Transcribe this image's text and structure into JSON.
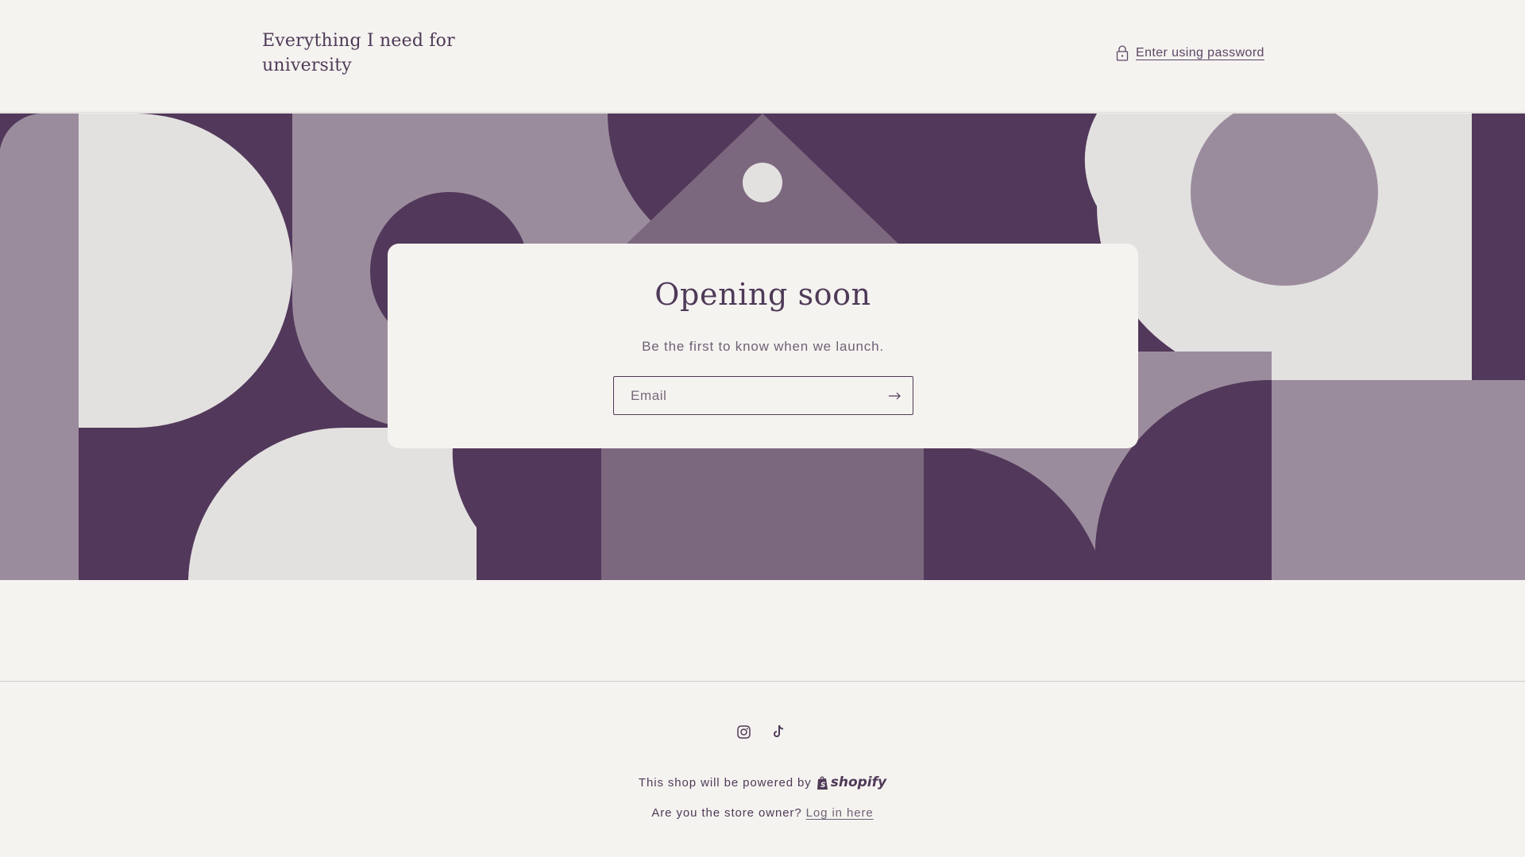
{
  "header": {
    "store_title": "Everything I need for university",
    "password_link": "Enter using password"
  },
  "hero": {
    "title": "Opening soon",
    "subtitle": "Be the first to know when we launch.",
    "email_placeholder": "Email",
    "email_value": ""
  },
  "footer": {
    "social_icons": [
      "instagram-icon",
      "tiktok-icon"
    ],
    "powered_by_text": "This shop will be powered by",
    "powered_by_brand": "shopify",
    "owner_question": "Are you the store owner?",
    "login_link": "Log in here"
  },
  "colors": {
    "background": "#f5f3f0",
    "plum_dark": "#52385a",
    "plum_mid": "#7c687e",
    "plum_light": "#9b8c9d",
    "shape_light": "#e3e1e0",
    "text": "#4f3a58"
  }
}
